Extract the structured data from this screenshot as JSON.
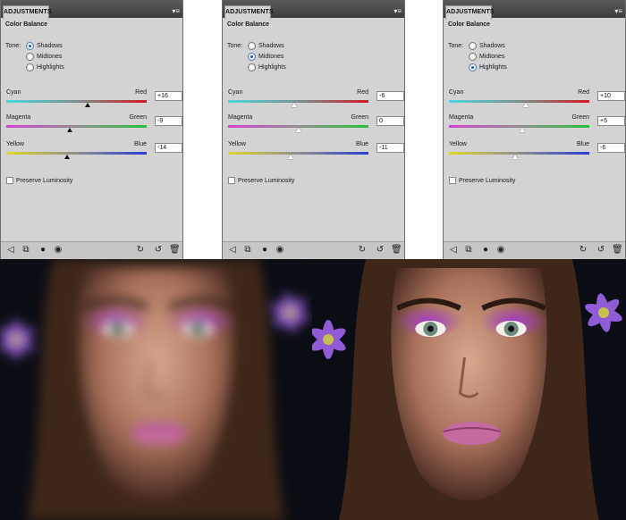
{
  "panels": [
    {
      "tab_label": "ADJUSTMENTS",
      "heading": "Color Balance",
      "tone_label": "Tone:",
      "tones": [
        "Shadows",
        "Midtones",
        "Highlights"
      ],
      "selected_tone": "Shadows",
      "sliders": [
        {
          "left": "Cyan",
          "right": "Red",
          "value": "+16"
        },
        {
          "left": "Magenta",
          "right": "Green",
          "value": "-9"
        },
        {
          "left": "Yellow",
          "right": "Blue",
          "value": "-14"
        }
      ],
      "preserve_label": "Preserve Luminosity"
    },
    {
      "tab_label": "ADJUSTMENTS",
      "heading": "Color Balance",
      "tone_label": "Tone:",
      "tones": [
        "Shadows",
        "Midtones",
        "Highlights"
      ],
      "selected_tone": "Midtones",
      "sliders": [
        {
          "left": "Cyan",
          "right": "Red",
          "value": "-6"
        },
        {
          "left": "Magenta",
          "right": "Green",
          "value": "0"
        },
        {
          "left": "Yellow",
          "right": "Blue",
          "value": "-11"
        }
      ],
      "preserve_label": "Preserve Luminosity"
    },
    {
      "tab_label": "ADJUSTMENTS",
      "heading": "Color Balance",
      "tone_label": "Tone:",
      "tones": [
        "Shadows",
        "Midtones",
        "Highlights"
      ],
      "selected_tone": "Highlights",
      "sliders": [
        {
          "left": "Cyan",
          "right": "Red",
          "value": "+10"
        },
        {
          "left": "Magenta",
          "right": "Green",
          "value": "+5"
        },
        {
          "left": "Yellow",
          "right": "Blue",
          "value": "-6"
        }
      ],
      "preserve_label": "Preserve Luminosity"
    }
  ],
  "bottom_icons": [
    "back-arrow-icon",
    "clip-layer-icon",
    "visibility-icon",
    "eye-icon",
    "view-previous-icon",
    "reset-icon",
    "trash-icon"
  ],
  "photos": {
    "left": {
      "kind": "blurred-portrait"
    },
    "right": {
      "kind": "portrait-purple-eyeshadow"
    }
  }
}
